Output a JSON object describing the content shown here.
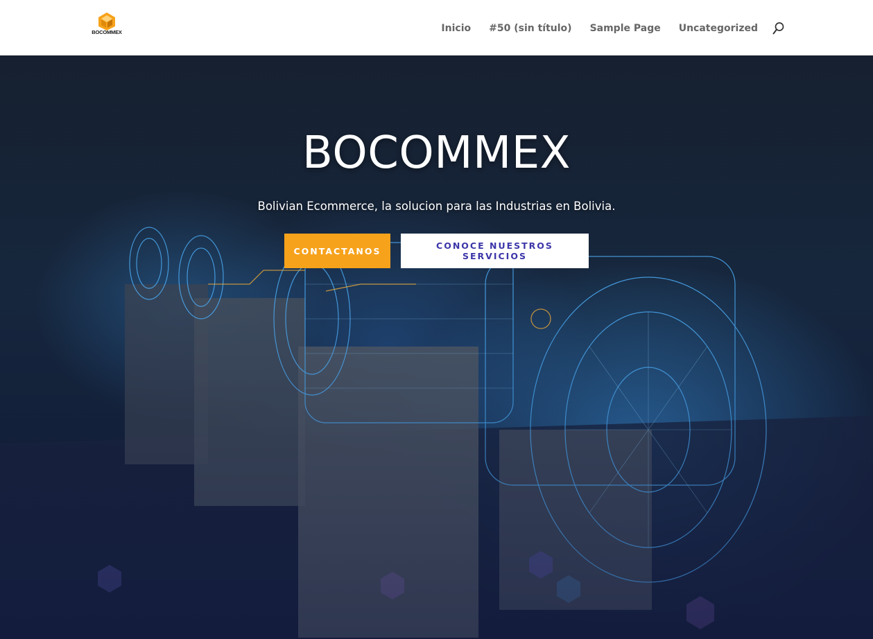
{
  "header": {
    "logo": {
      "text": "BOCOMMEX",
      "tagline": "Bolivian Ecommerce",
      "accent": "#f7a21b"
    },
    "nav": [
      {
        "label": "Inicio"
      },
      {
        "label": "#50 (sin título)"
      },
      {
        "label": "Sample Page"
      },
      {
        "label": "Uncategorized"
      }
    ],
    "search_icon": "search-icon"
  },
  "hero": {
    "title": "BOCOMMEX",
    "subtitle": "Bolivian Ecommerce, la solucion para las Industrias en Bolivia.",
    "buttons": {
      "primary": "CONTACTANOS",
      "secondary": "CONOCE NUESTROS SERVICIOS"
    },
    "background_image": "industrial-motors-wireframe-image"
  },
  "colors": {
    "accent_orange": "#f7a21b",
    "secondary_text": "#3b35a8",
    "nav_text": "#666666"
  }
}
